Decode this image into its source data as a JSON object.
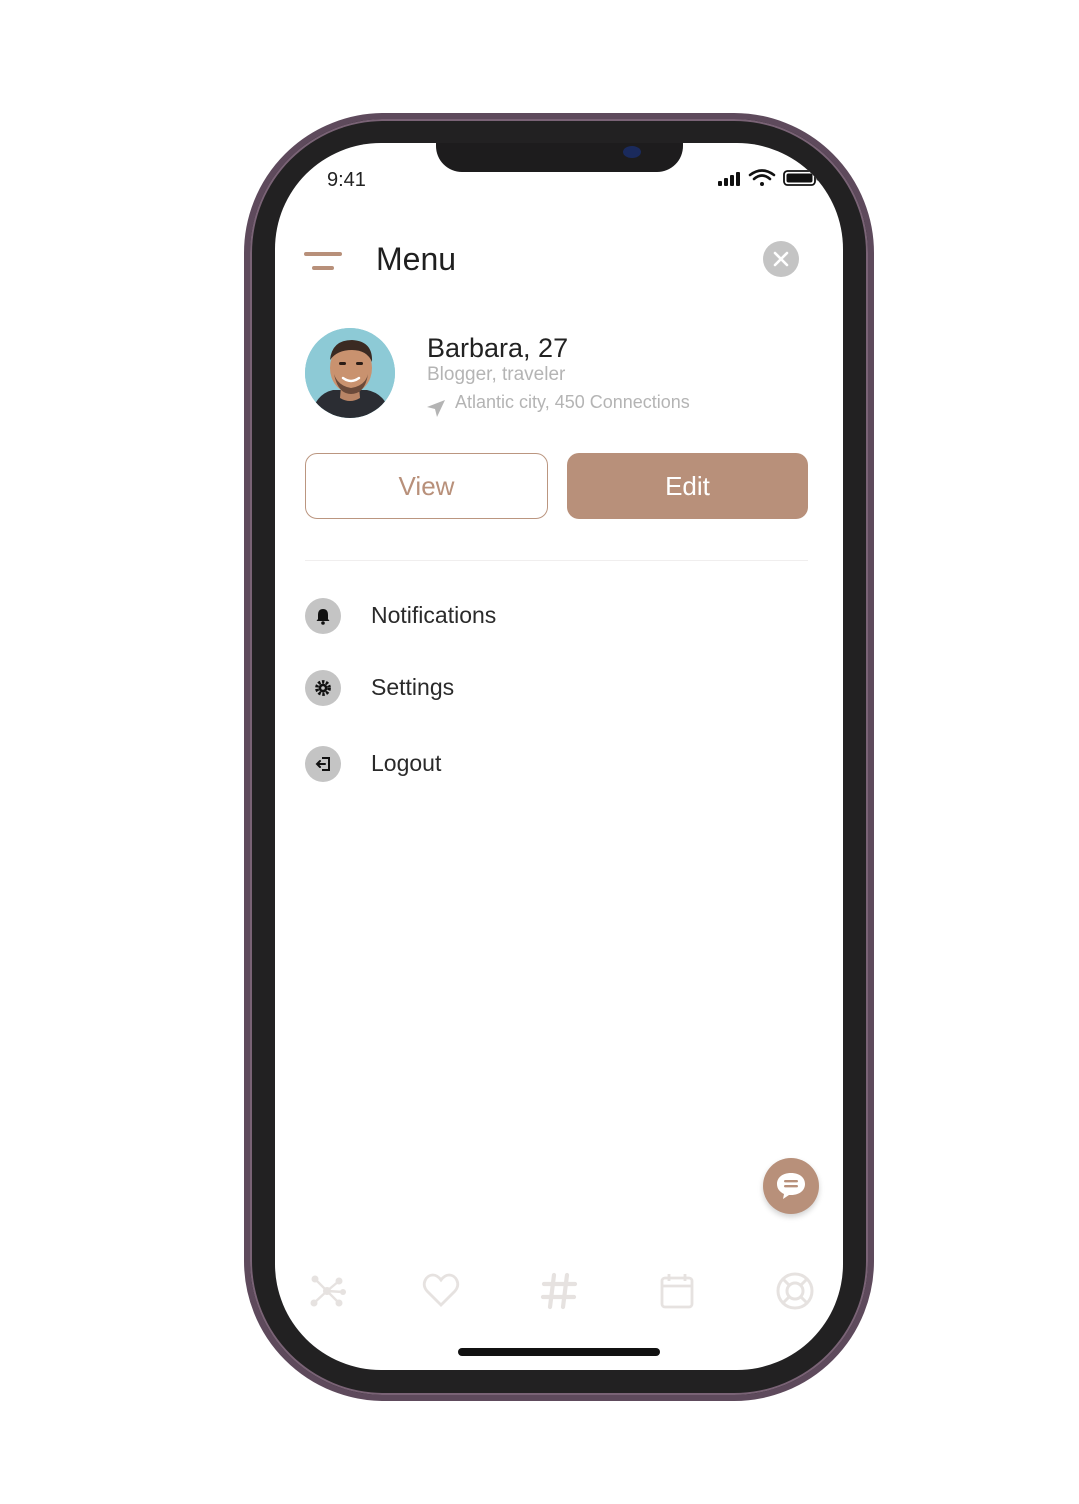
{
  "status_bar": {
    "time": "9:41"
  },
  "header": {
    "title": "Menu"
  },
  "profile": {
    "name": "Barbara, 27",
    "role": "Blogger, traveler",
    "location": "Atlantic city, 450 Connections"
  },
  "actions": {
    "view_label": "View",
    "edit_label": "Edit"
  },
  "menu": {
    "items": [
      {
        "label": "Notifications",
        "icon": "bell-icon"
      },
      {
        "label": "Settings",
        "icon": "gear-icon"
      },
      {
        "label": "Logout",
        "icon": "logout-icon"
      }
    ]
  },
  "tab_bar": {
    "icons": [
      "network-icon",
      "heart-icon",
      "hashtag-icon",
      "calendar-icon",
      "lifebuoy-icon"
    ]
  },
  "colors": {
    "accent": "#b8907a",
    "icon_bg": "#c4c4c4",
    "inactive_tab": "#e6e2e0",
    "frame": "#5e4a5c"
  }
}
